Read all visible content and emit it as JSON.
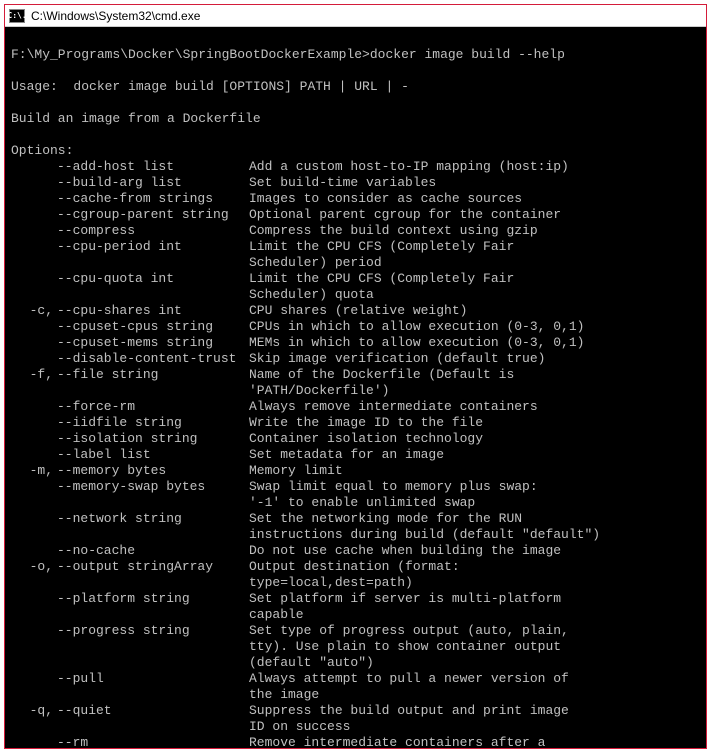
{
  "window": {
    "title": "C:\\Windows\\System32\\cmd.exe",
    "icon_text": "C:\\."
  },
  "terminal": {
    "prompt": "F:\\My_Programs\\Docker\\SpringBootDockerExample>",
    "command": "docker image build --help",
    "blank": " ",
    "usage": "Usage:  docker image build [OPTIONS] PATH | URL | -",
    "description": "Build an image from a Dockerfile",
    "options_header": "Options:",
    "options": [
      {
        "short": "",
        "long": "--add-host list",
        "desc": [
          "Add a custom host-to-IP mapping (host:ip)"
        ]
      },
      {
        "short": "",
        "long": "--build-arg list",
        "desc": [
          "Set build-time variables"
        ]
      },
      {
        "short": "",
        "long": "--cache-from strings",
        "desc": [
          "Images to consider as cache sources"
        ]
      },
      {
        "short": "",
        "long": "--cgroup-parent string",
        "desc": [
          "Optional parent cgroup for the container"
        ]
      },
      {
        "short": "",
        "long": "--compress",
        "desc": [
          "Compress the build context using gzip"
        ]
      },
      {
        "short": "",
        "long": "--cpu-period int",
        "desc": [
          "Limit the CPU CFS (Completely Fair",
          "Scheduler) period"
        ]
      },
      {
        "short": "",
        "long": "--cpu-quota int",
        "desc": [
          "Limit the CPU CFS (Completely Fair",
          "Scheduler) quota"
        ]
      },
      {
        "short": "-c,",
        "long": "--cpu-shares int",
        "desc": [
          "CPU shares (relative weight)"
        ]
      },
      {
        "short": "",
        "long": "--cpuset-cpus string",
        "desc": [
          "CPUs in which to allow execution (0-3, 0,1)"
        ]
      },
      {
        "short": "",
        "long": "--cpuset-mems string",
        "desc": [
          "MEMs in which to allow execution (0-3, 0,1)"
        ]
      },
      {
        "short": "",
        "long": "--disable-content-trust",
        "desc": [
          "Skip image verification (default true)"
        ]
      },
      {
        "short": "-f,",
        "long": "--file string",
        "desc": [
          "Name of the Dockerfile (Default is",
          "'PATH/Dockerfile')"
        ]
      },
      {
        "short": "",
        "long": "--force-rm",
        "desc": [
          "Always remove intermediate containers"
        ]
      },
      {
        "short": "",
        "long": "--iidfile string",
        "desc": [
          "Write the image ID to the file"
        ]
      },
      {
        "short": "",
        "long": "--isolation string",
        "desc": [
          "Container isolation technology"
        ]
      },
      {
        "short": "",
        "long": "--label list",
        "desc": [
          "Set metadata for an image"
        ]
      },
      {
        "short": "-m,",
        "long": "--memory bytes",
        "desc": [
          "Memory limit"
        ]
      },
      {
        "short": "",
        "long": "--memory-swap bytes",
        "desc": [
          "Swap limit equal to memory plus swap:",
          "'-1' to enable unlimited swap"
        ]
      },
      {
        "short": "",
        "long": "--network string",
        "desc": [
          "Set the networking mode for the RUN",
          "instructions during build (default \"default\")"
        ]
      },
      {
        "short": "",
        "long": "--no-cache",
        "desc": [
          "Do not use cache when building the image"
        ]
      },
      {
        "short": "-o,",
        "long": "--output stringArray",
        "desc": [
          "Output destination (format:",
          "type=local,dest=path)"
        ]
      },
      {
        "short": "",
        "long": "--platform string",
        "desc": [
          "Set platform if server is multi-platform",
          "capable"
        ]
      },
      {
        "short": "",
        "long": "--progress string",
        "desc": [
          "Set type of progress output (auto, plain,",
          "tty). Use plain to show container output",
          "(default \"auto\")"
        ]
      },
      {
        "short": "",
        "long": "--pull",
        "desc": [
          "Always attempt to pull a newer version of",
          "the image"
        ]
      },
      {
        "short": "-q,",
        "long": "--quiet",
        "desc": [
          "Suppress the build output and print image",
          "ID on success"
        ]
      },
      {
        "short": "",
        "long": "--rm",
        "desc": [
          "Remove intermediate containers after a"
        ]
      }
    ]
  }
}
